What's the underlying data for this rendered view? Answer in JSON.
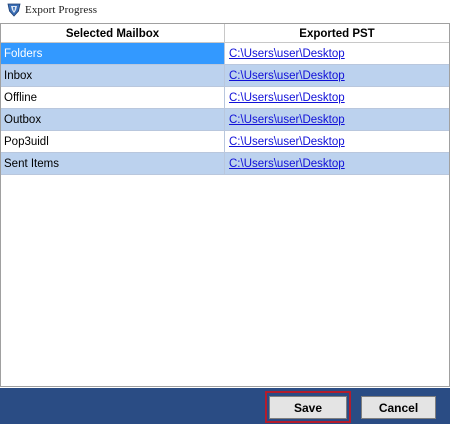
{
  "window": {
    "title": "Export Progress",
    "icon": "shield-logo-icon"
  },
  "grid": {
    "columns": [
      "Selected Mailbox",
      "Exported PST"
    ],
    "rows": [
      {
        "mailbox": "Folders",
        "path": "C:\\Users\\user\\Desktop",
        "selected": true
      },
      {
        "mailbox": "Inbox",
        "path": "C:\\Users\\user\\Desktop",
        "selected": false
      },
      {
        "mailbox": "Offline",
        "path": "C:\\Users\\user\\Desktop",
        "selected": false
      },
      {
        "mailbox": "Outbox",
        "path": "C:\\Users\\user\\Desktop",
        "selected": false
      },
      {
        "mailbox": "Pop3uidl",
        "path": "C:\\Users\\user\\Desktop",
        "selected": false
      },
      {
        "mailbox": "Sent Items",
        "path": "C:\\Users\\user\\Desktop",
        "selected": false
      }
    ]
  },
  "footer": {
    "save_label": "Save",
    "cancel_label": "Cancel"
  },
  "colors": {
    "selection": "#3399ff",
    "row_alt": "#bcd2ee",
    "footer": "#2a4c84",
    "highlight_border": "#b41c2c",
    "link": "#1010d8"
  }
}
